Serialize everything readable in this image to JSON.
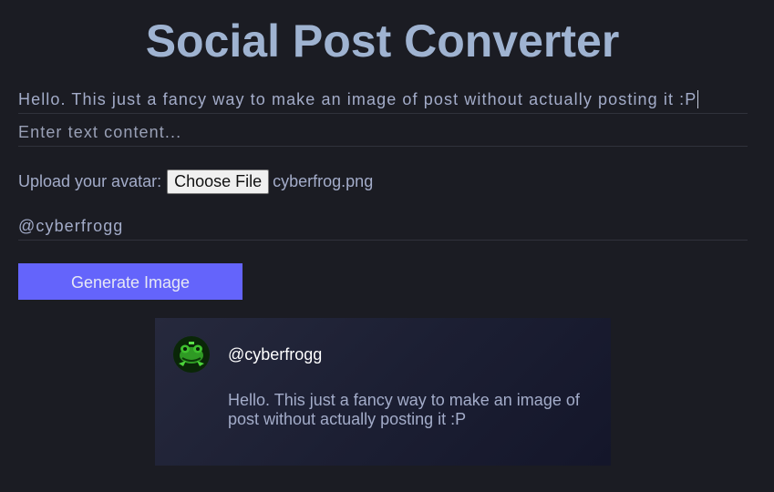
{
  "header": {
    "title": "Social Post Converter"
  },
  "form": {
    "post_text_value": "Hello. This just a fancy way to make an image of post without actually posting it :P",
    "content_placeholder": "Enter text content...",
    "upload_label": "Upload your avatar:",
    "choose_file_label": "Choose File",
    "file_name": "cyberfrog.png",
    "username_value": "@cyberfrogg",
    "generate_label": "Generate Image"
  },
  "preview": {
    "username": "@cyberfrogg",
    "text": "Hello. This just a fancy way to make an image of post without actually posting it :P",
    "avatar_icon": "frog-avatar-icon"
  },
  "colors": {
    "background": "#1b1c23",
    "accent": "#6464fb",
    "title": "#9fb3d1"
  }
}
